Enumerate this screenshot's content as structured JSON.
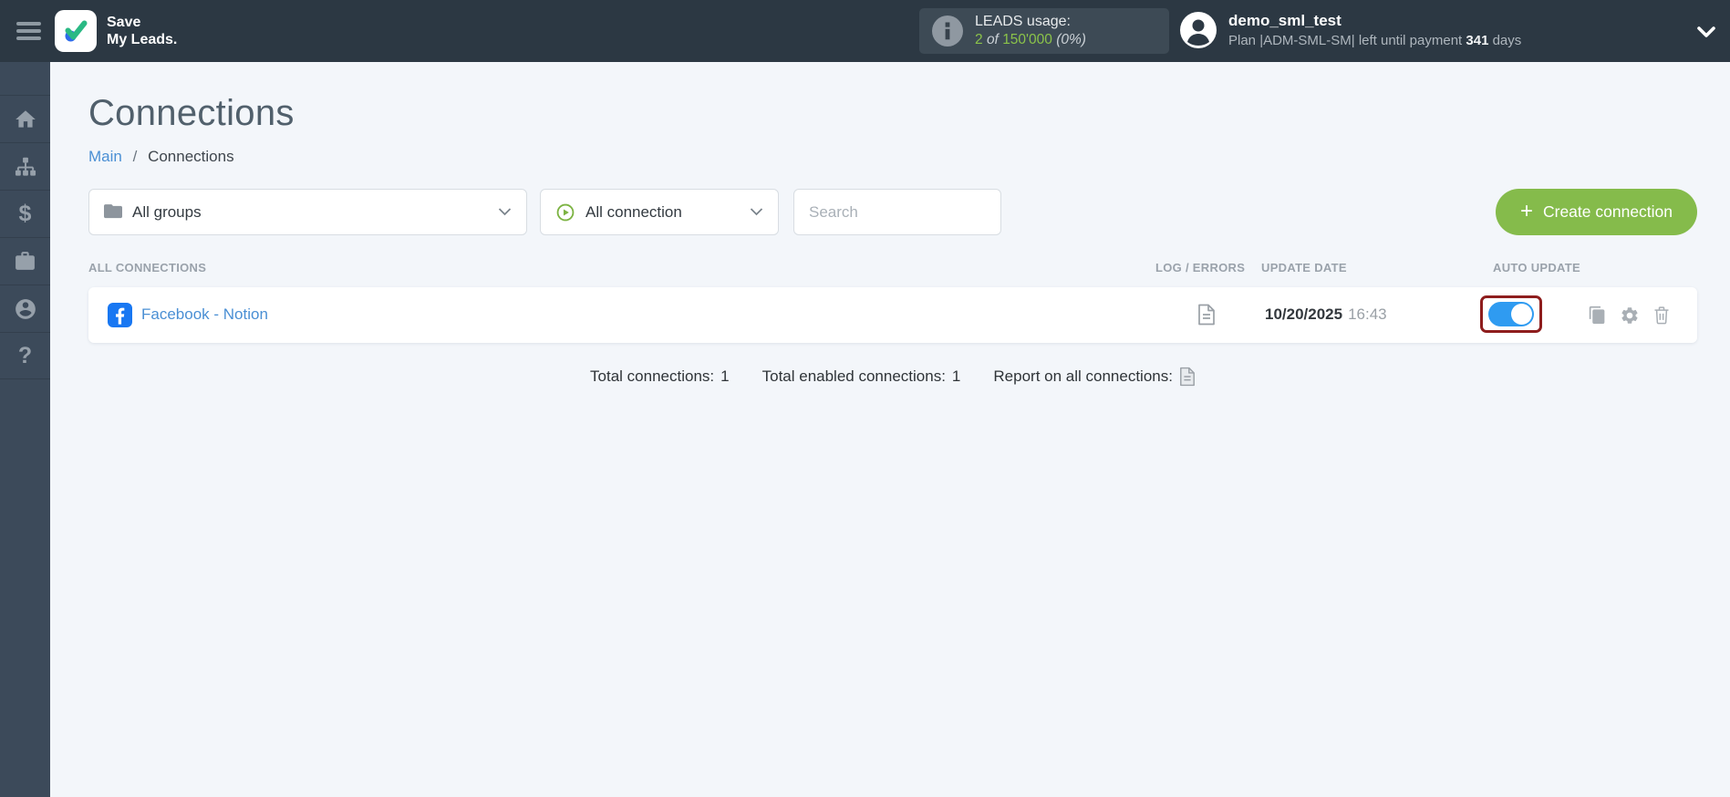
{
  "topbar": {
    "brand_line1": "Save",
    "brand_line2": "My Leads.",
    "leads": {
      "title": "LEADS usage:",
      "used": "2",
      "of_word": "of",
      "total": "150'000",
      "percent": "(0%)"
    },
    "user": {
      "name": "demo_sml_test",
      "plan_before": "Plan |ADM-SML-SM| left until payment",
      "days": "341",
      "plan_after": "days"
    }
  },
  "sidebar": {
    "icons": [
      "home",
      "sitemap",
      "billing",
      "services",
      "account",
      "help"
    ],
    "dollar_glyph": "$",
    "question_glyph": "?"
  },
  "page": {
    "title": "Connections",
    "breadcrumb_main": "Main",
    "breadcrumb_sep": "/",
    "breadcrumb_current": "Connections"
  },
  "filters": {
    "groups_label": "All groups",
    "connection_label": "All connection",
    "search_placeholder": "Search",
    "create_icon": "+",
    "create_label": "Create connection"
  },
  "table": {
    "header_connections": "ALL CONNECTIONS",
    "header_log": "LOG / ERRORS",
    "header_date": "UPDATE DATE",
    "header_auto": "AUTO UPDATE",
    "rows": [
      {
        "title": "Facebook - Notion",
        "date": "10/20/2025",
        "time": "16:43",
        "auto_update": true
      }
    ]
  },
  "totals": {
    "connections_label": "Total connections:",
    "connections_value": "1",
    "enabled_label": "Total enabled connections:",
    "enabled_value": "1",
    "report_label": "Report on all connections:"
  },
  "colors": {
    "topbar_bg": "#2c3843",
    "sidebar_bg": "#3c4a5a",
    "main_bg": "#f3f6fa",
    "accent_green": "#85bb4b",
    "leads_green": "#8bc34a",
    "link_blue": "#4a8fd4",
    "facebook_blue": "#1877f2",
    "toggle_blue": "#2f9bf1",
    "highlight_red": "#8e1d1d"
  }
}
